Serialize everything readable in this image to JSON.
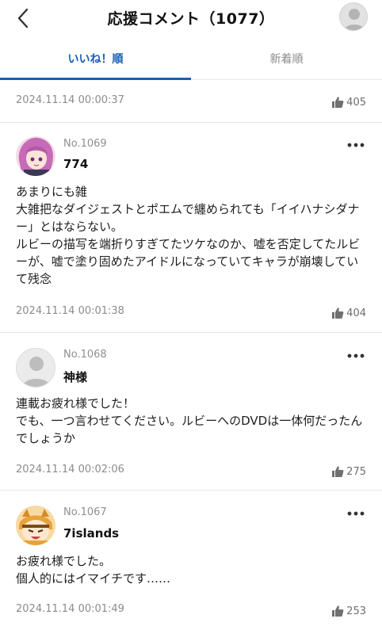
{
  "header": {
    "title": "応援コメント（1077）",
    "back_icon": "chevron-left-icon",
    "avatar_icon": "user-avatar-icon"
  },
  "tabs": [
    {
      "label": "いいね！順",
      "active": true
    },
    {
      "label": "新着順",
      "active": false
    }
  ],
  "colors": {
    "accent": "#1a5fb4",
    "muted_text": "#8c8c8c",
    "divider": "#e4e4e4"
  },
  "top_item": {
    "timestamp": "2024.11.14 00:00:37",
    "likes": "405"
  },
  "comments": [
    {
      "number": "No.1069",
      "username": "774",
      "avatar": "anime-girl-avatar",
      "body": "あまりにも雑\n大雑把なダイジェストとポエムで纏められても「イイハナシダナー」とはならない。\nルビーの描写を端折りすぎてたツケなのか、嘘を否定してたルビーが、嘘で塗り固めたアイドルになっていてキャラが崩壊していて残念",
      "timestamp": "2024.11.14 00:01:38",
      "likes": "404"
    },
    {
      "number": "No.1068",
      "username": "神様",
      "avatar": "default-user-avatar",
      "body": "連載お疲れ様でした！\nでも、一つ言わせてください。ルビーへのDVDは一体何だったんでしょうか",
      "timestamp": "2024.11.14 00:02:06",
      "likes": "275"
    },
    {
      "number": "No.1067",
      "username": "7islands",
      "avatar": "anime-character-avatar",
      "body": "お疲れ様でした。\n個人的にはイマイチです……",
      "timestamp": "2024.11.14 00:01:49",
      "likes": "253"
    }
  ]
}
